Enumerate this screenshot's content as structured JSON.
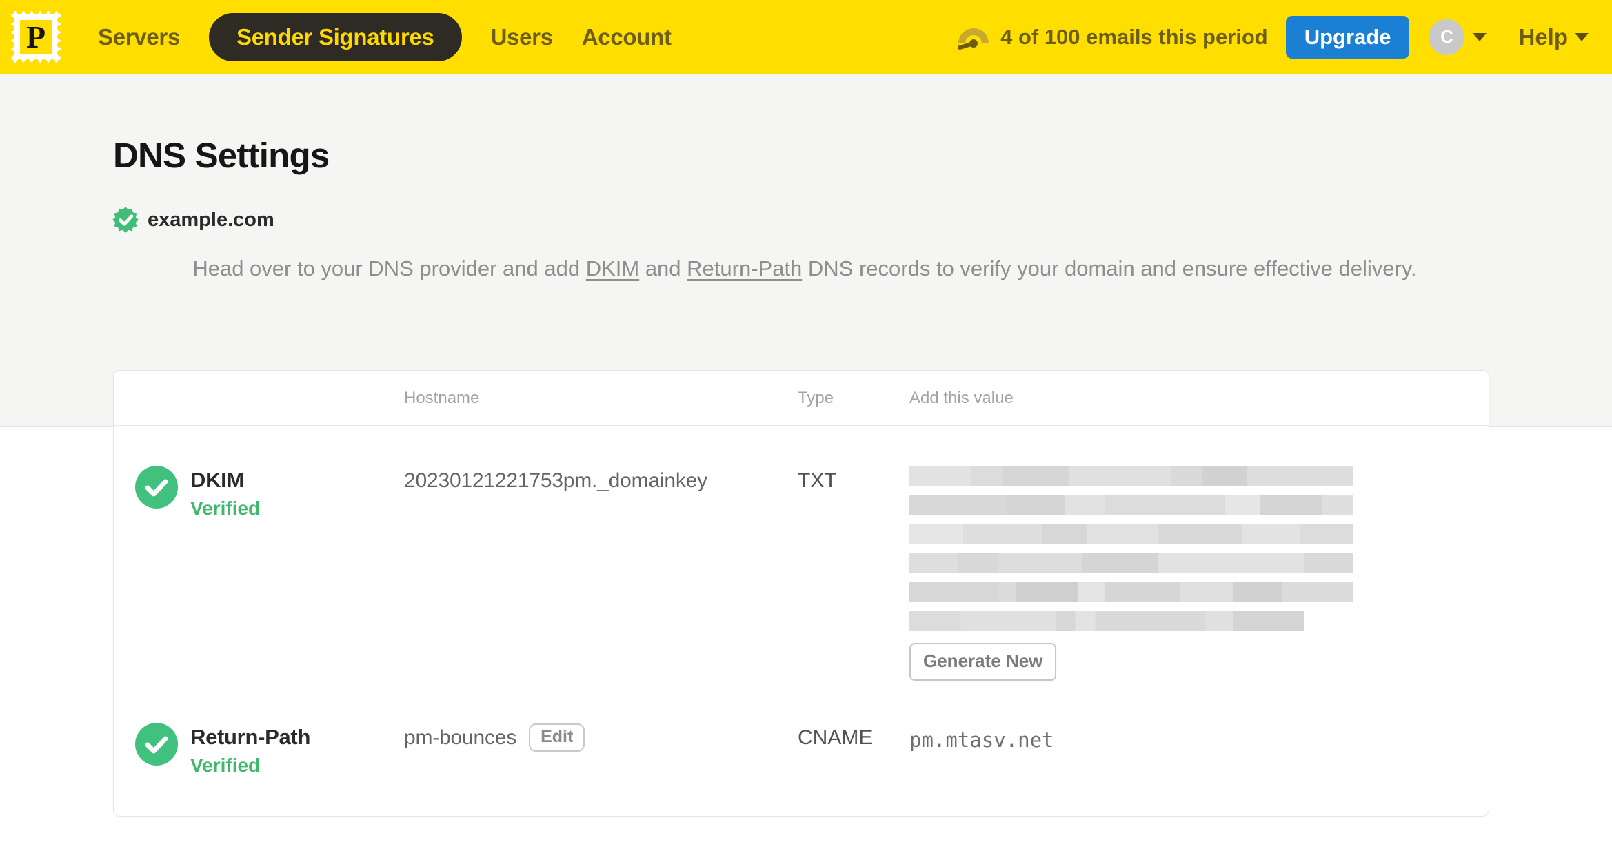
{
  "brand": {
    "logo_letter": "P"
  },
  "navbar": {
    "items": [
      {
        "label": "Servers",
        "active": false
      },
      {
        "label": "Sender Signatures",
        "active": true
      },
      {
        "label": "Users",
        "active": false
      },
      {
        "label": "Account",
        "active": false
      }
    ],
    "usage_text": "4 of 100 emails this period",
    "upgrade_label": "Upgrade",
    "avatar_initial": "C",
    "help_label": "Help"
  },
  "page": {
    "title": "DNS Settings",
    "domain": "example.com",
    "description": {
      "part1": "Head over to your DNS provider and add ",
      "dkim_link": "DKIM",
      "part2": " and ",
      "return_path_link": "Return-Path",
      "part3": " DNS records to verify your domain and ensure effective delivery."
    }
  },
  "table": {
    "headers": {
      "hostname": "Hostname",
      "type": "Type",
      "value": "Add this value"
    },
    "rows": [
      {
        "name": "DKIM",
        "status": "Verified",
        "hostname": "20230121221753pm._domainkey",
        "type": "TXT",
        "value_redacted": true,
        "action_label": "Generate New"
      },
      {
        "name": "Return-Path",
        "status": "Verified",
        "hostname": "pm-bounces",
        "edit_label": "Edit",
        "type": "CNAME",
        "value": "pm.mtasv.net"
      }
    ]
  },
  "colors": {
    "brand_yellow": "#FFDE00",
    "nav_text_olive": "#6c5e16",
    "active_pill_bg": "#2e2b25",
    "accent_blue": "#1b7fd4",
    "success_green": "#41c17e",
    "verified_text_green": "#3cb96b"
  }
}
